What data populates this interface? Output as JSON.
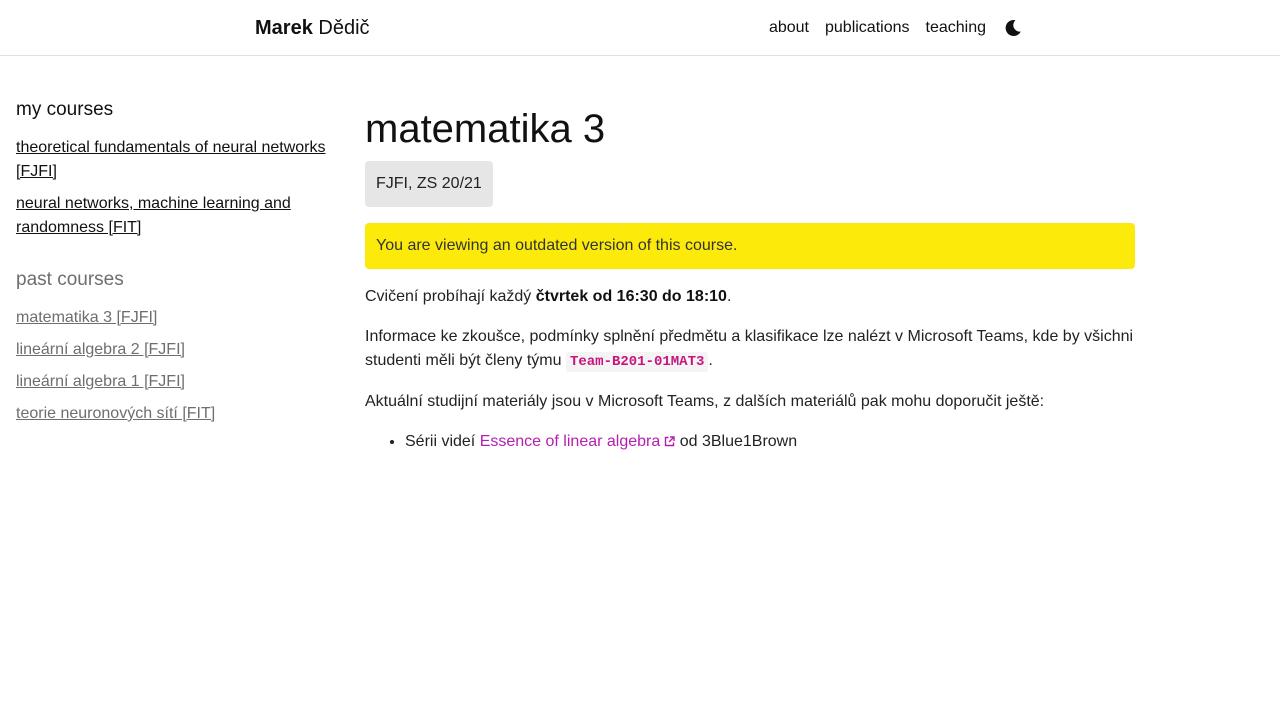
{
  "header": {
    "brand_first": "Marek",
    "brand_last": "Dědič",
    "nav": [
      "about",
      "publications",
      "teaching"
    ],
    "theme_icon": "moon-icon"
  },
  "sidebar": {
    "my_courses_title": "my courses",
    "my_courses": [
      "theoretical fundamentals of neural networks [FJFI]",
      "neural networks, machine learning and randomness [FIT]"
    ],
    "past_courses_title": "past courses",
    "past_courses": [
      "matematika 3 [FJFI]",
      "lineární algebra 2 [FJFI]",
      "lineární algebra 1 [FJFI]",
      "teorie neuronových sítí [FIT]"
    ]
  },
  "main": {
    "title": "matematika 3",
    "term": "FJFI, ZS 20/21",
    "alert": "You are viewing an outdated version of this course.",
    "p1_prefix": "Cvičení probíhají každý ",
    "p1_strong": "čtvrtek od 16:30 do 18:10",
    "p1_suffix": ".",
    "p2_prefix": "Informace ke zkoušce, podmínky splnění předmětu a klasifikace lze nalézt v Microsoft Teams, kde by všichni studenti měli být členy týmu ",
    "p2_code": "Team-B201-01MAT3",
    "p2_suffix": ".",
    "p3": "Aktuální studijní materiály jsou v Microsoft Teams, z dalších materiálů pak mohu doporučit ještě:",
    "li1_prefix": "Sérii videí ",
    "li1_link": "Essence of linear algebra",
    "li1_suffix": " od 3Blue1Brown"
  },
  "colors": {
    "alert_bg": "#fcea0b",
    "link_accent": "#b51eb0",
    "code_color": "#c7157e"
  }
}
